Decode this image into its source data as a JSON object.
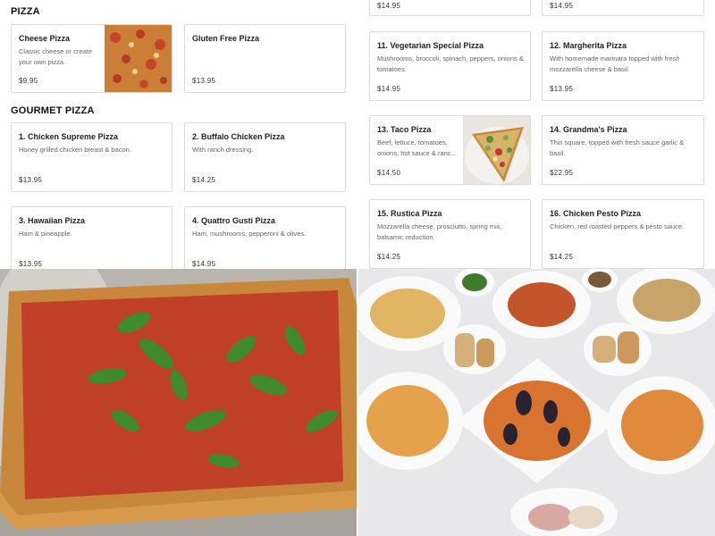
{
  "pizza": {
    "title": "PIZZA",
    "items": [
      {
        "name": "Cheese Pizza",
        "desc": "Classic cheese or create your own pizza.",
        "price": "$9.95"
      },
      {
        "name": "Gluten Free Pizza",
        "desc": "",
        "price": "$13.95"
      }
    ]
  },
  "gourmet": {
    "title": "GOURMET PIZZA",
    "items": [
      {
        "name": "1. Chicken Supreme Pizza",
        "desc": "Honey grilled chicken breast & bacon.",
        "price": "$13.95"
      },
      {
        "name": "2. Buffalo Chicken Pizza",
        "desc": "With ranch dressing.",
        "price": "$14.25"
      },
      {
        "name": "3. Hawaiian Pizza",
        "desc": "Ham & pineapple.",
        "price": "$13.95"
      },
      {
        "name": "4. Quattro Gusti Pizza",
        "desc": "Ham, mushrooms, pepperoni & olives.",
        "price": "$14.95"
      }
    ]
  },
  "right": {
    "top_prices": [
      "$14.95",
      "$14.95"
    ],
    "items": [
      {
        "name": "11. Vegetarian Special Pizza",
        "desc": "Mushrooms, broccoli, spinach, peppers, onions & tomatoes.",
        "price": "$14.95"
      },
      {
        "name": "12. Margherita Pizza",
        "desc": "With homemade marinara topped with fresh mozzarella cheese & basil.",
        "price": "$13.95"
      },
      {
        "name": "13. Taco Pizza",
        "desc": "Beef, lettuce, tomatoes, onions, hot sauce & ranc...",
        "price": "$14.50"
      },
      {
        "name": "14. Grandma's Pizza",
        "desc": "Thin square, topped with fresh sauce garlic & basil.",
        "price": "$22.95"
      },
      {
        "name": "15. Rustica Pizza",
        "desc": "Mozzarella cheese, prosciutto, spring mix, balsamic reduction.",
        "price": "$14.25"
      },
      {
        "name": "16. Chicken Pesto Pizza",
        "desc": "Chicken, red roasted peppers & pesto sauce.",
        "price": "$14.25"
      }
    ]
  },
  "photos": {
    "left": "grandma-pizza-photo",
    "right": "pasta-dishes-photo"
  }
}
